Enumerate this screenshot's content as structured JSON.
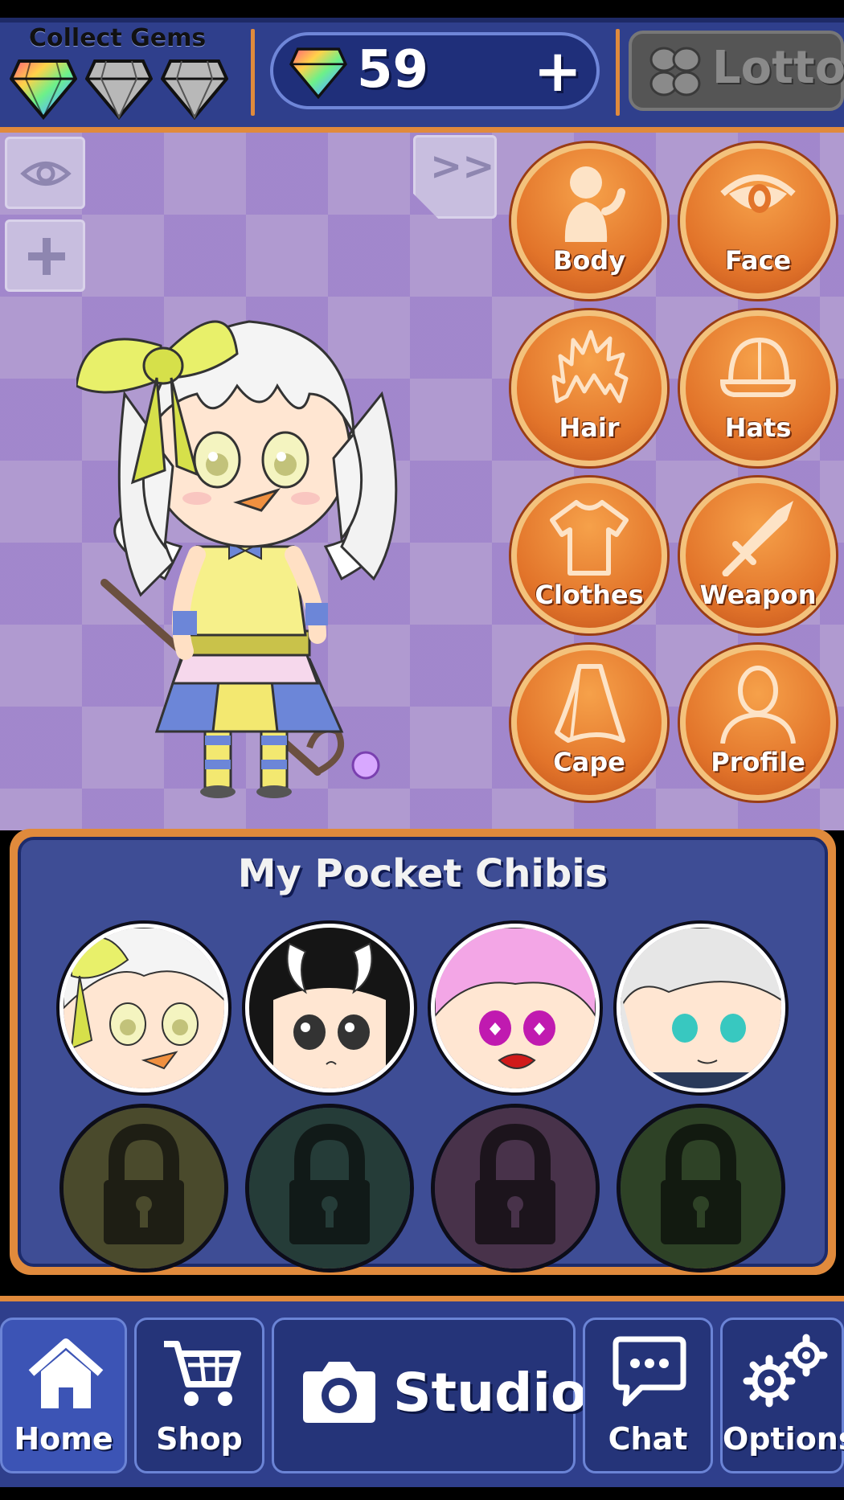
{
  "header": {
    "collect_gems_label": "Collect Gems",
    "gem_slots": [
      {
        "name": "rainbow-gem",
        "collected": true
      },
      {
        "name": "grey-gem",
        "collected": false
      },
      {
        "name": "grey-gem",
        "collected": false
      }
    ],
    "gem_count": "59",
    "add_gems_label": "+",
    "lotto_label": "Lotto"
  },
  "stage": {
    "toggle_view_icon": "eye-icon",
    "add_icon": "plus-icon",
    "expand_label": ">>",
    "categories": [
      {
        "label": "Body",
        "icon": "body-icon"
      },
      {
        "label": "Face",
        "icon": "eye-icon"
      },
      {
        "label": "Hair",
        "icon": "hair-icon"
      },
      {
        "label": "Hats",
        "icon": "cap-icon"
      },
      {
        "label": "Clothes",
        "icon": "shirt-icon"
      },
      {
        "label": "Weapon",
        "icon": "sword-icon"
      },
      {
        "label": "Cape",
        "icon": "cape-icon"
      },
      {
        "label": "Profile",
        "icon": "profile-icon"
      }
    ]
  },
  "chibis_panel": {
    "title": "My Pocket Chibis",
    "slots": [
      {
        "state": "unlocked",
        "hair_color": "#f4f4f4",
        "accent": "#e8f06a"
      },
      {
        "state": "unlocked",
        "hair_color": "#151515",
        "accent": "#ffffff"
      },
      {
        "state": "unlocked",
        "hair_color": "#f3a6e6",
        "accent": "#c01ab0"
      },
      {
        "state": "unlocked",
        "hair_color": "#e6e6e6",
        "accent": "#38c8c0"
      },
      {
        "state": "locked",
        "tint": "#4a4a2c"
      },
      {
        "state": "locked",
        "tint": "#253c38"
      },
      {
        "state": "locked",
        "tint": "#48324a"
      },
      {
        "state": "locked",
        "tint": "#2e4226"
      }
    ]
  },
  "nav": {
    "home": "Home",
    "shop": "Shop",
    "studio": "Studio",
    "chat": "Chat",
    "options": "Options"
  },
  "colors": {
    "accent_orange": "#e08a3c",
    "nav_blue": "#2f3f8c",
    "category_orange": "#e2742a"
  }
}
